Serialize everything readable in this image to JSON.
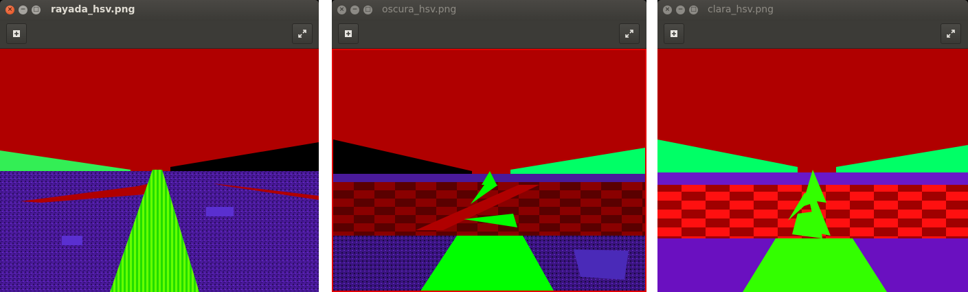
{
  "windows": [
    {
      "title": "rayada_hsv.png",
      "focused": true
    },
    {
      "title": "oscura_hsv.png",
      "focused": false
    },
    {
      "title": "clara_hsv.png",
      "focused": false
    }
  ],
  "toolbar": {
    "add_icon": "plus-square-icon",
    "fullscreen_icon": "expand-arrows-icon"
  },
  "colors": {
    "sky": "#b00000",
    "ground": "#5a1fa8",
    "green": "#00ff55",
    "lime": "#44ff00",
    "red": "#ff0000"
  }
}
